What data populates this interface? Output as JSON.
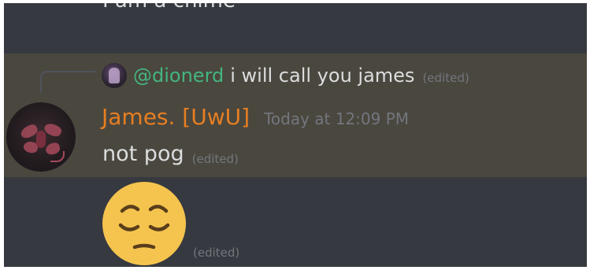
{
  "previous_message": {
    "text": "I am a chime"
  },
  "reply": {
    "mention": "@dionerd",
    "text": "i will call you james",
    "edited": "(edited)"
  },
  "message": {
    "username": "James. [UwU]",
    "timestamp": "Today at 12:09 PM",
    "text": "not pog",
    "edited": "(edited)"
  },
  "emoji_message": {
    "emoji": "pensive-face-emoji",
    "edited": "(edited)"
  },
  "colors": {
    "background": "#36393f",
    "highlight": "#4a473f",
    "username": "#e67e22",
    "mention": "#43b581",
    "text": "#dcddde",
    "muted": "#72767d",
    "emoji_face": "#f4c44e"
  }
}
